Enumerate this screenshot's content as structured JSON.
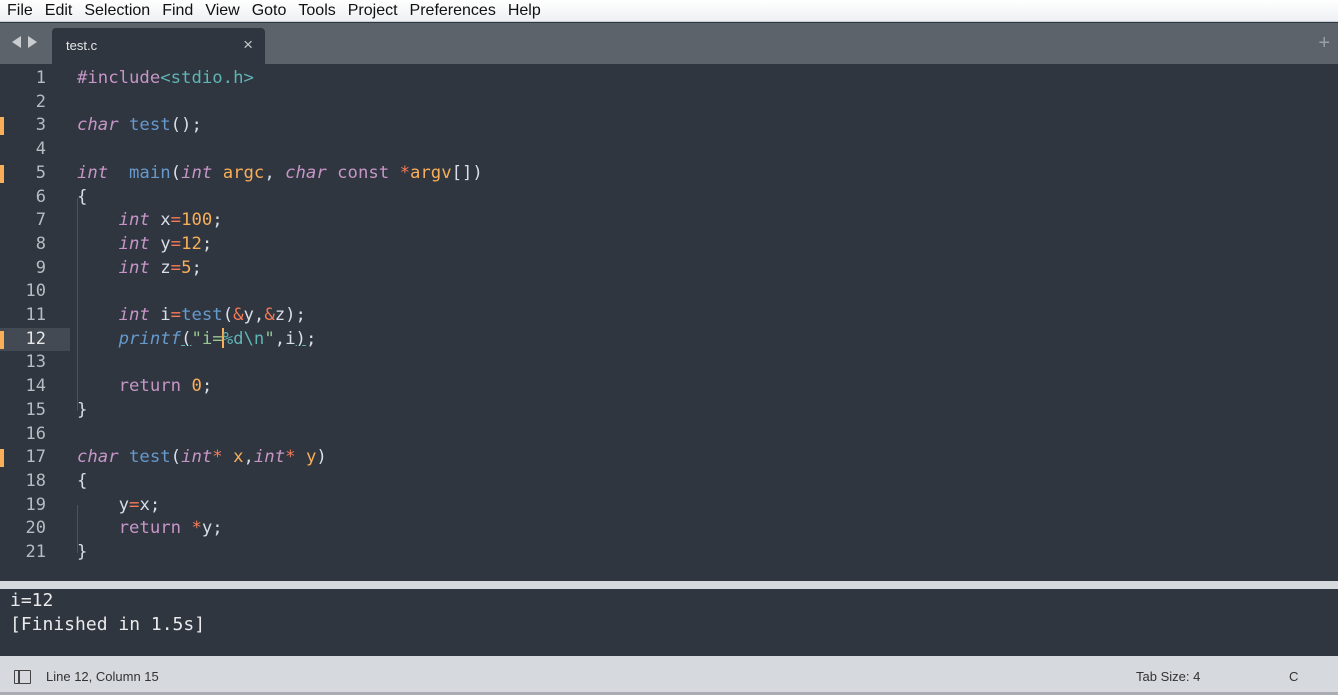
{
  "menu": [
    "File",
    "Edit",
    "Selection",
    "Find",
    "View",
    "Goto",
    "Tools",
    "Project",
    "Preferences",
    "Help"
  ],
  "tab": {
    "title": "test.c",
    "close_glyph": "×",
    "new_tab_glyph": "+"
  },
  "editor": {
    "line_numbers": [
      "1",
      "2",
      "3",
      "4",
      "5",
      "6",
      "7",
      "8",
      "9",
      "10",
      "11",
      "12",
      "13",
      "14",
      "15",
      "16",
      "17",
      "18",
      "19",
      "20",
      "21"
    ],
    "current_line": 12,
    "modified_lines": [
      3,
      5,
      12,
      17
    ],
    "lines": [
      "#include<stdio.h>",
      "",
      "char test();",
      "",
      "int  main(int argc, char const *argv[])",
      "{",
      "    int x=100;",
      "    int y=12;",
      "    int z=5;",
      "",
      "    int i=test(&y,&z);",
      "    printf(\"i=%d\\n\",i);",
      "",
      "    return 0;",
      "}",
      "",
      "char test(int* x,int* y)",
      "{",
      "    y=x;",
      "    return *y;",
      "}"
    ]
  },
  "output": {
    "lines": [
      "i=12",
      "[Finished in 1.5s]"
    ]
  },
  "status": {
    "position": "Line 12, Column 15",
    "tab_size": "Tab Size: 4",
    "syntax": "C"
  },
  "colors": {
    "accent": "#f9ae58",
    "background": "#2f3640",
    "keyword": "#c695c6",
    "function": "#6699cc",
    "string": "#99c794",
    "operator": "#f97b58"
  }
}
